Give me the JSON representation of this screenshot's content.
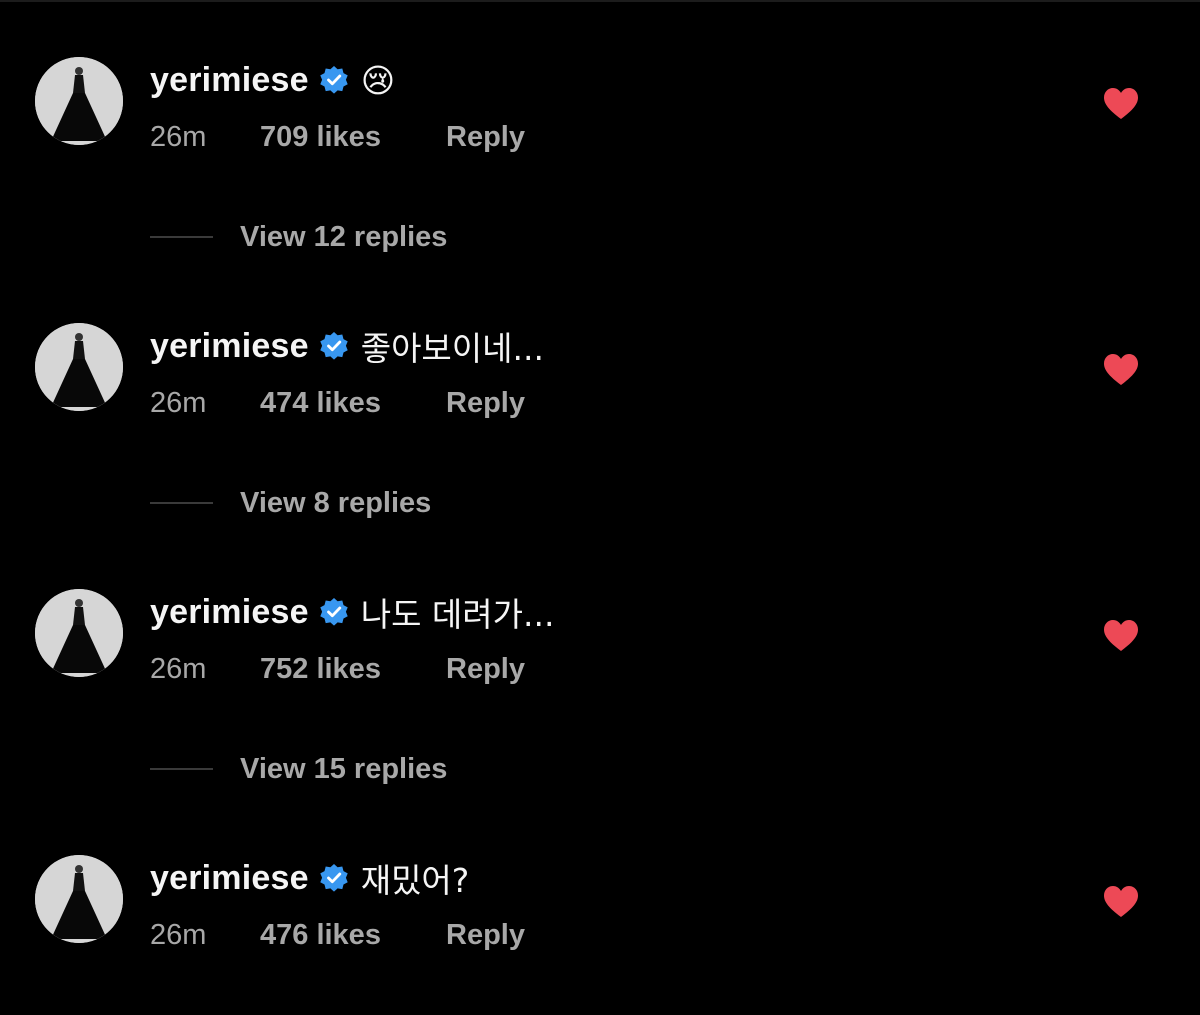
{
  "accent_colors": {
    "background": "#000000",
    "verified_badge": "#3897f0",
    "heart": "#ed4956",
    "secondary_text": "#a8a8a8"
  },
  "comments": [
    {
      "username": "yerimiese",
      "verified": true,
      "text": "😢",
      "time": "26m",
      "likes": "709 likes",
      "reply": "Reply",
      "liked": true,
      "view_replies": "View 12 replies"
    },
    {
      "username": "yerimiese",
      "verified": true,
      "text": "좋아보이네...",
      "time": "26m",
      "likes": "474 likes",
      "reply": "Reply",
      "liked": true,
      "view_replies": "View 8 replies"
    },
    {
      "username": "yerimiese",
      "verified": true,
      "text": "나도 데려가...",
      "time": "26m",
      "likes": "752 likes",
      "reply": "Reply",
      "liked": true,
      "view_replies": "View 15 replies"
    },
    {
      "username": "yerimiese",
      "verified": true,
      "text": "재밌어?",
      "time": "26m",
      "likes": "476 likes",
      "reply": "Reply",
      "liked": true
    }
  ]
}
